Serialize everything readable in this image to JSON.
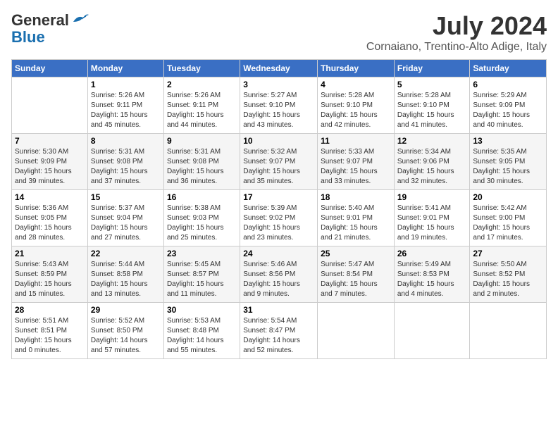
{
  "logo": {
    "line1a": "General",
    "line1b": "Blue"
  },
  "title": "July 2024",
  "location": "Cornaiano, Trentino-Alto Adige, Italy",
  "weekdays": [
    "Sunday",
    "Monday",
    "Tuesday",
    "Wednesday",
    "Thursday",
    "Friday",
    "Saturday"
  ],
  "weeks": [
    [
      {
        "day": "",
        "info": ""
      },
      {
        "day": "1",
        "info": "Sunrise: 5:26 AM\nSunset: 9:11 PM\nDaylight: 15 hours\nand 45 minutes."
      },
      {
        "day": "2",
        "info": "Sunrise: 5:26 AM\nSunset: 9:11 PM\nDaylight: 15 hours\nand 44 minutes."
      },
      {
        "day": "3",
        "info": "Sunrise: 5:27 AM\nSunset: 9:10 PM\nDaylight: 15 hours\nand 43 minutes."
      },
      {
        "day": "4",
        "info": "Sunrise: 5:28 AM\nSunset: 9:10 PM\nDaylight: 15 hours\nand 42 minutes."
      },
      {
        "day": "5",
        "info": "Sunrise: 5:28 AM\nSunset: 9:10 PM\nDaylight: 15 hours\nand 41 minutes."
      },
      {
        "day": "6",
        "info": "Sunrise: 5:29 AM\nSunset: 9:09 PM\nDaylight: 15 hours\nand 40 minutes."
      }
    ],
    [
      {
        "day": "7",
        "info": "Sunrise: 5:30 AM\nSunset: 9:09 PM\nDaylight: 15 hours\nand 39 minutes."
      },
      {
        "day": "8",
        "info": "Sunrise: 5:31 AM\nSunset: 9:08 PM\nDaylight: 15 hours\nand 37 minutes."
      },
      {
        "day": "9",
        "info": "Sunrise: 5:31 AM\nSunset: 9:08 PM\nDaylight: 15 hours\nand 36 minutes."
      },
      {
        "day": "10",
        "info": "Sunrise: 5:32 AM\nSunset: 9:07 PM\nDaylight: 15 hours\nand 35 minutes."
      },
      {
        "day": "11",
        "info": "Sunrise: 5:33 AM\nSunset: 9:07 PM\nDaylight: 15 hours\nand 33 minutes."
      },
      {
        "day": "12",
        "info": "Sunrise: 5:34 AM\nSunset: 9:06 PM\nDaylight: 15 hours\nand 32 minutes."
      },
      {
        "day": "13",
        "info": "Sunrise: 5:35 AM\nSunset: 9:05 PM\nDaylight: 15 hours\nand 30 minutes."
      }
    ],
    [
      {
        "day": "14",
        "info": "Sunrise: 5:36 AM\nSunset: 9:05 PM\nDaylight: 15 hours\nand 28 minutes."
      },
      {
        "day": "15",
        "info": "Sunrise: 5:37 AM\nSunset: 9:04 PM\nDaylight: 15 hours\nand 27 minutes."
      },
      {
        "day": "16",
        "info": "Sunrise: 5:38 AM\nSunset: 9:03 PM\nDaylight: 15 hours\nand 25 minutes."
      },
      {
        "day": "17",
        "info": "Sunrise: 5:39 AM\nSunset: 9:02 PM\nDaylight: 15 hours\nand 23 minutes."
      },
      {
        "day": "18",
        "info": "Sunrise: 5:40 AM\nSunset: 9:01 PM\nDaylight: 15 hours\nand 21 minutes."
      },
      {
        "day": "19",
        "info": "Sunrise: 5:41 AM\nSunset: 9:01 PM\nDaylight: 15 hours\nand 19 minutes."
      },
      {
        "day": "20",
        "info": "Sunrise: 5:42 AM\nSunset: 9:00 PM\nDaylight: 15 hours\nand 17 minutes."
      }
    ],
    [
      {
        "day": "21",
        "info": "Sunrise: 5:43 AM\nSunset: 8:59 PM\nDaylight: 15 hours\nand 15 minutes."
      },
      {
        "day": "22",
        "info": "Sunrise: 5:44 AM\nSunset: 8:58 PM\nDaylight: 15 hours\nand 13 minutes."
      },
      {
        "day": "23",
        "info": "Sunrise: 5:45 AM\nSunset: 8:57 PM\nDaylight: 15 hours\nand 11 minutes."
      },
      {
        "day": "24",
        "info": "Sunrise: 5:46 AM\nSunset: 8:56 PM\nDaylight: 15 hours\nand 9 minutes."
      },
      {
        "day": "25",
        "info": "Sunrise: 5:47 AM\nSunset: 8:54 PM\nDaylight: 15 hours\nand 7 minutes."
      },
      {
        "day": "26",
        "info": "Sunrise: 5:49 AM\nSunset: 8:53 PM\nDaylight: 15 hours\nand 4 minutes."
      },
      {
        "day": "27",
        "info": "Sunrise: 5:50 AM\nSunset: 8:52 PM\nDaylight: 15 hours\nand 2 minutes."
      }
    ],
    [
      {
        "day": "28",
        "info": "Sunrise: 5:51 AM\nSunset: 8:51 PM\nDaylight: 15 hours\nand 0 minutes."
      },
      {
        "day": "29",
        "info": "Sunrise: 5:52 AM\nSunset: 8:50 PM\nDaylight: 14 hours\nand 57 minutes."
      },
      {
        "day": "30",
        "info": "Sunrise: 5:53 AM\nSunset: 8:48 PM\nDaylight: 14 hours\nand 55 minutes."
      },
      {
        "day": "31",
        "info": "Sunrise: 5:54 AM\nSunset: 8:47 PM\nDaylight: 14 hours\nand 52 minutes."
      },
      {
        "day": "",
        "info": ""
      },
      {
        "day": "",
        "info": ""
      },
      {
        "day": "",
        "info": ""
      }
    ]
  ]
}
